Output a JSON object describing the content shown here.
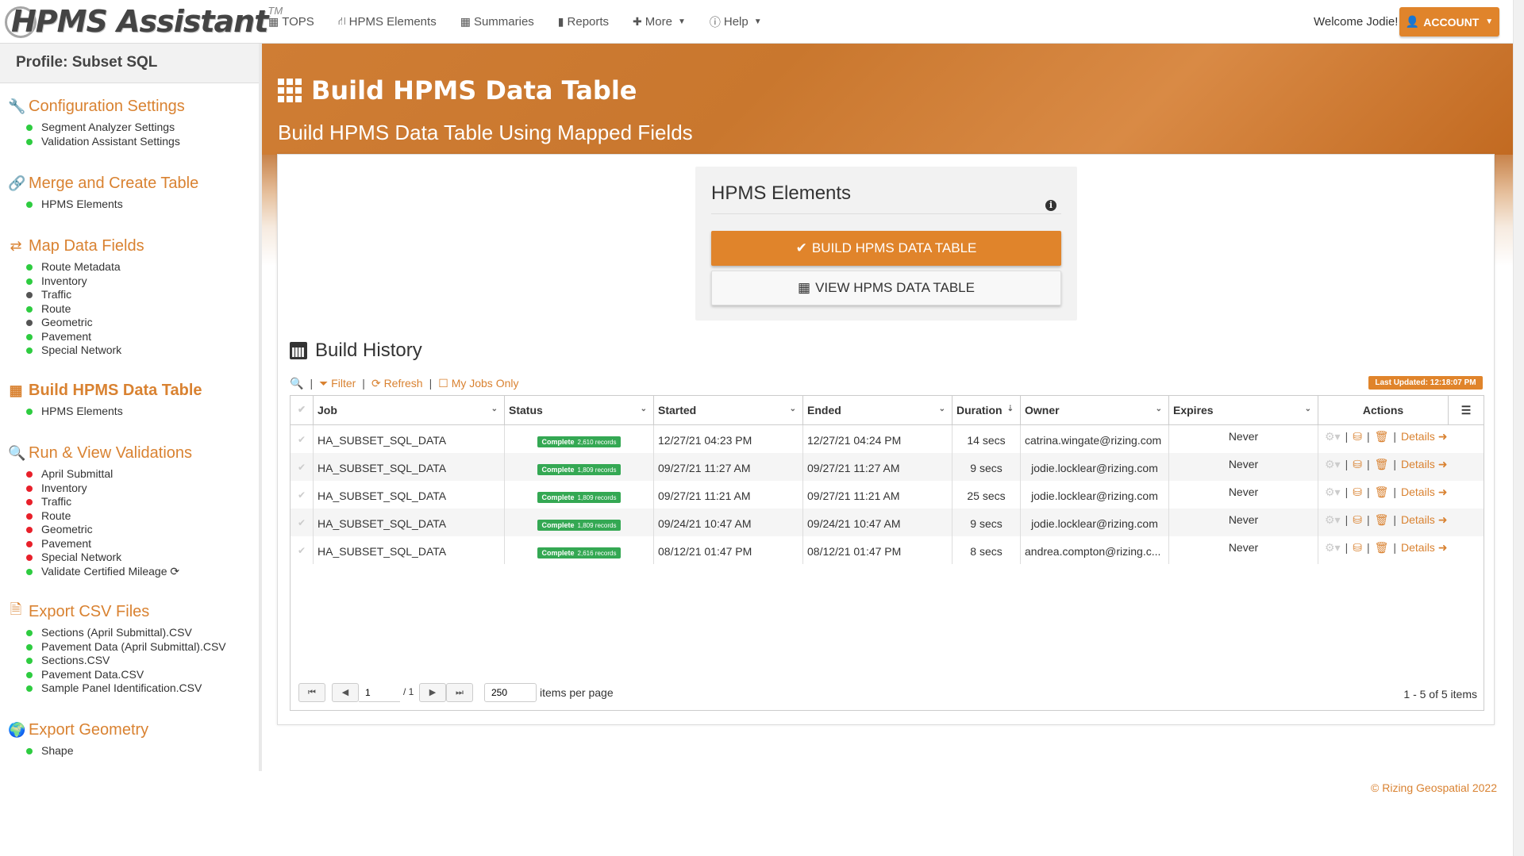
{
  "app": {
    "logo_text": "HPMS Assistant",
    "logo_tm": "TM"
  },
  "nav": {
    "items": [
      {
        "label": "TOPS",
        "icon": "table-icon"
      },
      {
        "label": "HPMS Elements",
        "icon": "road-icon"
      },
      {
        "label": "Summaries",
        "icon": "table-icon"
      },
      {
        "label": "Reports",
        "icon": "bar-chart-icon"
      },
      {
        "label": "More",
        "icon": "plus-icon"
      },
      {
        "label": "Help",
        "icon": "info-icon"
      }
    ],
    "welcome": "Welcome Jodie!",
    "account_label": "ACCOUNT"
  },
  "sidebar": {
    "profile": "Profile: Subset SQL",
    "sections": [
      {
        "title": "Configuration Settings",
        "items": [
          {
            "label": "Segment Analyzer Settings",
            "status": "green"
          },
          {
            "label": "Validation Assistant Settings",
            "status": "green"
          }
        ]
      },
      {
        "title": "Merge and Create Table",
        "items": [
          {
            "label": "HPMS Elements",
            "status": "green"
          }
        ]
      },
      {
        "title": "Map Data Fields",
        "items": [
          {
            "label": "Route Metadata",
            "status": "green"
          },
          {
            "label": "Inventory",
            "status": "green"
          },
          {
            "label": "Traffic",
            "status": "gray"
          },
          {
            "label": "Route",
            "status": "green"
          },
          {
            "label": "Geometric",
            "status": "gray"
          },
          {
            "label": "Pavement",
            "status": "green"
          },
          {
            "label": "Special Network",
            "status": "green"
          }
        ]
      },
      {
        "title": "Build HPMS Data Table",
        "active": true,
        "items": [
          {
            "label": "HPMS Elements",
            "status": "green"
          }
        ]
      },
      {
        "title": "Run & View Validations",
        "items": [
          {
            "label": "April Submittal",
            "status": "red"
          },
          {
            "label": "Inventory",
            "status": "red"
          },
          {
            "label": "Traffic",
            "status": "red"
          },
          {
            "label": "Route",
            "status": "red"
          },
          {
            "label": "Geometric",
            "status": "red"
          },
          {
            "label": "Pavement",
            "status": "red"
          },
          {
            "label": "Special Network",
            "status": "red"
          },
          {
            "label": "Validate Certified Mileage",
            "status": "green"
          }
        ]
      },
      {
        "title": "Export CSV Files",
        "items": [
          {
            "label": "Sections (April Submittal).CSV",
            "status": "green"
          },
          {
            "label": "Pavement Data (April Submittal).CSV",
            "status": "green"
          },
          {
            "label": "Sections.CSV",
            "status": "green"
          },
          {
            "label": "Pavement Data.CSV",
            "status": "green"
          },
          {
            "label": "Sample Panel Identification.CSV",
            "status": "green"
          }
        ]
      },
      {
        "title": "Export Geometry",
        "items": [
          {
            "label": "Shape",
            "status": "green"
          }
        ]
      }
    ]
  },
  "banner": {
    "title": "Build HPMS Data Table",
    "subtitle": "Build HPMS Data Table Using Mapped Fields"
  },
  "elements_panel": {
    "title": "HPMS Elements",
    "build_button": "BUILD HPMS DATA TABLE",
    "view_button": "VIEW HPMS DATA TABLE"
  },
  "history": {
    "title": "Build History",
    "toolbar": {
      "filter": "Filter",
      "refresh": "Refresh",
      "my_jobs": "My Jobs Only"
    },
    "last_updated": "Last Updated: 12:18:07 PM",
    "columns": [
      "Job",
      "Status",
      "Started",
      "Ended",
      "Duration",
      "Owner",
      "Expires",
      "Actions"
    ],
    "rows": [
      {
        "job": "HA_SUBSET_SQL_DATA",
        "status": "Complete",
        "records": "2,610 records",
        "started": "12/27/21 04:23 PM",
        "ended": "12/27/21 04:24 PM",
        "duration": "14 secs",
        "owner": "catrina.wingate@rizing.com",
        "expires": "Never",
        "details": "Details"
      },
      {
        "job": "HA_SUBSET_SQL_DATA",
        "status": "Complete",
        "records": "1,809 records",
        "started": "09/27/21 11:27 AM",
        "ended": "09/27/21 11:27 AM",
        "duration": "9 secs",
        "owner": "jodie.locklear@rizing.com",
        "expires": "Never",
        "details": "Details"
      },
      {
        "job": "HA_SUBSET_SQL_DATA",
        "status": "Complete",
        "records": "1,809 records",
        "started": "09/27/21 11:21 AM",
        "ended": "09/27/21 11:21 AM",
        "duration": "25 secs",
        "owner": "jodie.locklear@rizing.com",
        "expires": "Never",
        "details": "Details"
      },
      {
        "job": "HA_SUBSET_SQL_DATA",
        "status": "Complete",
        "records": "1,809 records",
        "started": "09/24/21 10:47 AM",
        "ended": "09/24/21 10:47 AM",
        "duration": "9 secs",
        "owner": "jodie.locklear@rizing.com",
        "expires": "Never",
        "details": "Details"
      },
      {
        "job": "HA_SUBSET_SQL_DATA",
        "status": "Complete",
        "records": "2,616 records",
        "started": "08/12/21 01:47 PM",
        "ended": "08/12/21 01:47 PM",
        "duration": "8 secs",
        "owner": "andrea.compton@rizing.c...",
        "expires": "Never",
        "details": "Details"
      }
    ],
    "pager": {
      "page": "1",
      "of": "/ 1",
      "page_size": "250",
      "per_page_label": "items per page",
      "summary": "1 - 5 of 5 items"
    }
  },
  "footer": "Rizing Geospatial 2022",
  "colors": {
    "accent": "#e0842b",
    "link": "#d98231",
    "complete": "#34a853"
  }
}
